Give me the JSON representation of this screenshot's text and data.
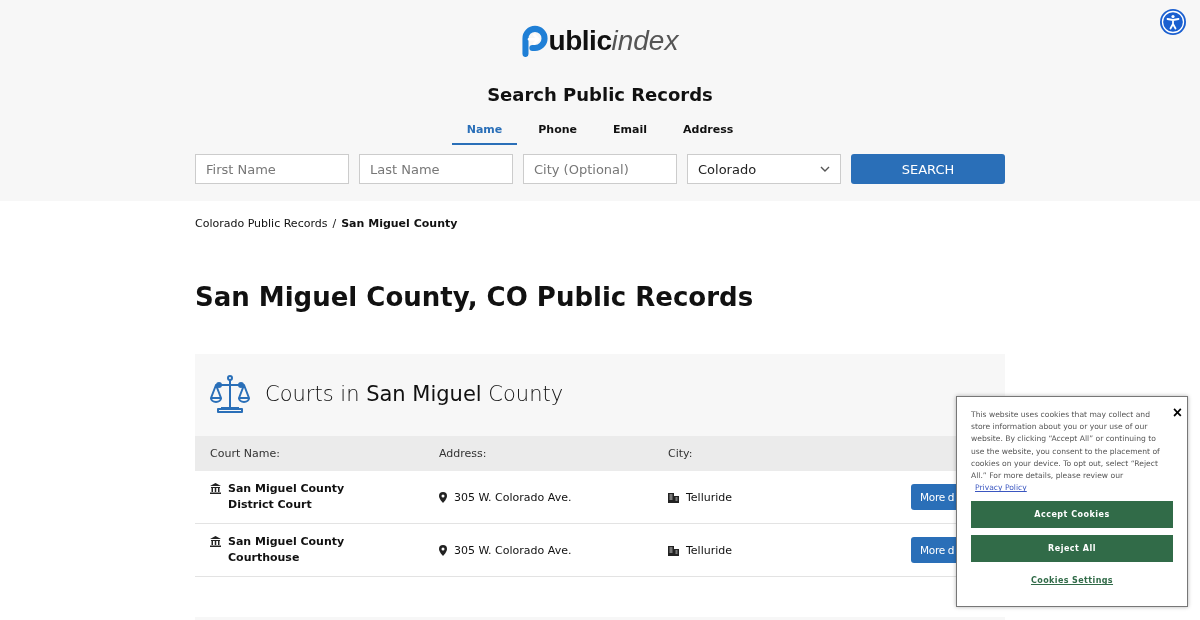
{
  "logo": {
    "bold": "ublic",
    "light": "index"
  },
  "search": {
    "title": "Search Public Records",
    "tabs": [
      {
        "label": "Name",
        "selected": true
      },
      {
        "label": "Phone",
        "selected": false
      },
      {
        "label": "Email",
        "selected": false
      },
      {
        "label": "Address",
        "selected": false
      }
    ],
    "fields": [
      {
        "placeholder": "First Name"
      },
      {
        "placeholder": "Last Name"
      },
      {
        "placeholder": "City (Optional)"
      }
    ],
    "state_select": "Colorado",
    "button": "SEARCH"
  },
  "breadcrumb": [
    {
      "label": "Colorado Public Records",
      "current": false
    },
    {
      "label": "San Miguel County",
      "current": true
    }
  ],
  "breadcrumb_separator": "/",
  "heading": "San Miguel County, CO Public Records",
  "courts": {
    "title": "Courts in **San Miguel** County",
    "columns": [
      "Court Name:",
      "Address:",
      "City:"
    ],
    "rows": [
      {
        "name": "San Miguel County District Court",
        "address": "305 W. Colorado Ave.",
        "city": "Telluride",
        "button": "More d"
      },
      {
        "name": "San Miguel County Courthouse",
        "address": "305 W. Colorado Ave.",
        "city": "Telluride",
        "button": "More d"
      }
    ]
  },
  "cookie_banner": {
    "text": "This website uses cookies that may collect and store information about you or your use of our website. By clicking “Accept All” or continuing to use the website, you consent to the placement of cookies on your device. To opt out, select “Reject All.” For more details, please review our",
    "link": "Privacy Policy",
    "close": "×",
    "buttons": [
      "Accept Cookies",
      "Reject All"
    ],
    "settings": "Cookies Settings"
  }
}
